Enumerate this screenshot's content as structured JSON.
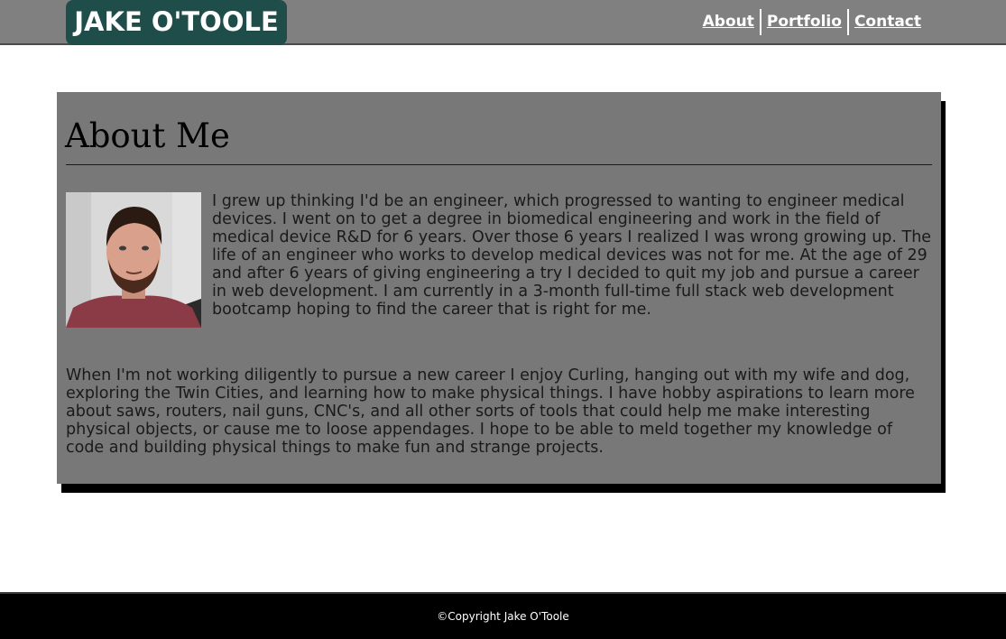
{
  "header": {
    "logo_text": "JAKE O'TOOLE",
    "nav": [
      {
        "label": "About"
      },
      {
        "label": "Portfolio"
      },
      {
        "label": "Contact"
      }
    ]
  },
  "about": {
    "title": "About Me",
    "photo_alt": "portrait photo",
    "paragraph1": "I grew up thinking I'd be an engineer, which progressed to wanting to engineer medical devices. I went on to get a degree in biomedical engineering and work in the field of medical device R&D for 6 years. Over those 6 years I realized I was wrong growing up. The life of an engineer who works to develop medical devices was not for me. At the age of 29 and after 6 years of giving engineering a try I decided to quit my job and pursue a career in web development. I am currently in a 3-month full-time full stack web development bootcamp hoping to find the career that is right for me.",
    "paragraph2": "When I'm not working diligently to pursue a new career I enjoy Curling, hanging out with my wife and dog, exploring the Twin Cities, and learning how to make physical things. I have hobby aspirations to learn more about saws, routers, nail guns, CNC's, and all other sorts of tools that could help me make interesting physical objects, or cause me to loose appendages. I hope to be able to meld together my knowledge of code and building physical things to make fun and strange projects."
  },
  "footer": {
    "copyright": "©Copyright Jake O'Toole"
  },
  "colors": {
    "header_bg": "#808080",
    "logo_bg": "#1f4e4a",
    "card_bg": "#787878",
    "footer_bg": "#000000"
  }
}
